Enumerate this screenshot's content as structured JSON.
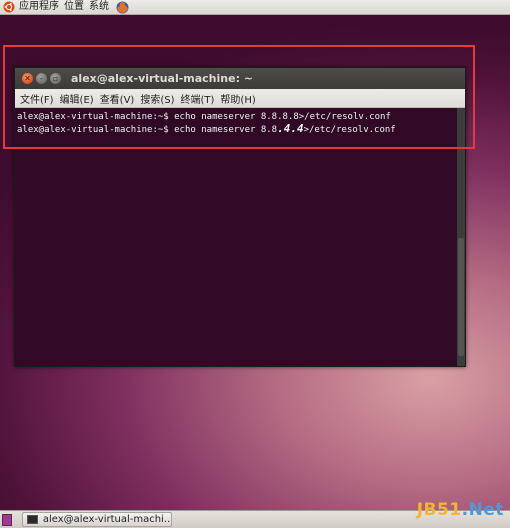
{
  "top_panel": {
    "menu": [
      "应用程序",
      "位置",
      "系统"
    ]
  },
  "window": {
    "title": "alex@alex-virtual-machine: ~",
    "menu": [
      "文件(F)",
      "编辑(E)",
      "查看(V)",
      "搜索(S)",
      "终端(T)",
      "帮助(H)"
    ]
  },
  "terminal": {
    "line1": "alex@alex-virtual-machine:~$ echo nameserver 8.8.8.8>/etc/resolv.conf",
    "line2_prefix": "alex@alex-virtual-machine:~$ echo nameserver 8.8",
    "line2_big": ".4.4",
    "line2_suffix": ">/etc/resolv.conf"
  },
  "taskbar": {
    "task_label": "alex@alex-virtual-machi..."
  },
  "watermark": {
    "part1": "JB51",
    "part2": ".Net"
  },
  "colors": {
    "accent_red": "#e33a3c",
    "terminal_bg": "#300a24",
    "close_button": "#e0511e"
  },
  "icons": {
    "ubuntu": "ubuntu-logo-icon",
    "firefox": "firefox-icon",
    "terminal": "terminal-icon"
  }
}
